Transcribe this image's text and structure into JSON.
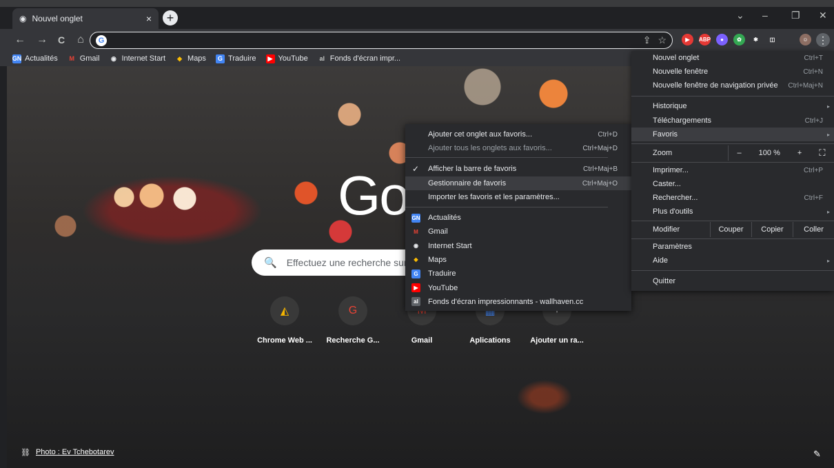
{
  "tab": {
    "title": "Nouvel onglet",
    "close": "×",
    "new_tab": "+"
  },
  "window_controls": {
    "collapse": "⌄",
    "minimize": "–",
    "restore": "❐",
    "close": "✕"
  },
  "nav": {
    "back": "←",
    "forward": "→",
    "reload": "C",
    "home": "⌂"
  },
  "omnibox": {
    "value": "",
    "google_icon": "G"
  },
  "omni_icons": {
    "share": "⇪",
    "star": "☆"
  },
  "extensions": [
    {
      "name": "red-circle-ext-icon",
      "label": "▶",
      "color": "#e53935"
    },
    {
      "name": "abp-ext-icon",
      "label": "ABP",
      "color": "#e53935"
    },
    {
      "name": "purple-ext-icon",
      "label": "●",
      "color": "#7b61ff"
    },
    {
      "name": "green-ext-icon",
      "label": "✿",
      "color": "#34a853"
    },
    {
      "name": "puzzle-ext-icon",
      "label": "✱",
      "color": "#35363a"
    },
    {
      "name": "sidepanel-icon",
      "label": "◫",
      "color": "#35363a"
    }
  ],
  "menu_button": "⋮",
  "bookmarks": [
    {
      "label": "Actualités",
      "icon": "GN",
      "color": "#4285f4"
    },
    {
      "label": "Gmail",
      "icon": "M",
      "color": "#35363a",
      "fg": "#ea4335"
    },
    {
      "label": "Internet Start",
      "icon": "◉",
      "color": "#35363a",
      "fg": "#e8eaed"
    },
    {
      "label": "Maps",
      "icon": "◆",
      "color": "#35363a",
      "fg": "#fbbc04"
    },
    {
      "label": "Traduire",
      "icon": "G",
      "color": "#4285f4"
    },
    {
      "label": "YouTube",
      "icon": "▶",
      "color": "#ff0000"
    },
    {
      "label": "Fonds d'écran impr...",
      "icon": "al",
      "color": "#35363a",
      "fg": "#c4c7c5"
    }
  ],
  "page": {
    "google_logo": "Go",
    "search_placeholder": "Effectuez une recherche sur",
    "search_icon": "🔍",
    "shortcuts": [
      {
        "name": "Chrome Web ...",
        "icon": "◭",
        "color": "#f4b400"
      },
      {
        "name": "Recherche G...",
        "icon": "G",
        "color": "#ea4335"
      },
      {
        "name": "Gmail",
        "icon": "M",
        "color": "#ea4335"
      },
      {
        "name": "Aplications",
        "icon": "▦",
        "color": "#4285f4"
      },
      {
        "name": "Ajouter un ra...",
        "icon": "+",
        "color": "#e8eaed"
      }
    ],
    "photo_credit": "Photo : Ev Tchebotarev",
    "link_icon": "⛓",
    "pencil_icon": "✎"
  },
  "main_menu": {
    "items": [
      {
        "label": "Nouvel onglet",
        "shortcut": "Ctrl+T"
      },
      {
        "label": "Nouvelle fenêtre",
        "shortcut": "Ctrl+N"
      },
      {
        "label": "Nouvelle fenêtre de navigation privée",
        "shortcut": "Ctrl+Maj+N"
      },
      {
        "label": "Historique",
        "shortcut": ""
      },
      {
        "label": "Téléchargements",
        "shortcut": "Ctrl+J"
      },
      {
        "label": "Favoris",
        "shortcut": ""
      },
      {
        "label": "Imprimer...",
        "shortcut": "Ctrl+P"
      },
      {
        "label": "Caster...",
        "shortcut": ""
      },
      {
        "label": "Rechercher...",
        "shortcut": "Ctrl+F"
      },
      {
        "label": "Plus d'outils",
        "shortcut": ""
      },
      {
        "label": "Paramètres",
        "shortcut": ""
      },
      {
        "label": "Aide",
        "shortcut": ""
      },
      {
        "label": "Quitter",
        "shortcut": ""
      }
    ],
    "zoom": {
      "label": "Zoom",
      "minus": "–",
      "value": "100 %",
      "plus": "+",
      "fullscreen": "⛶"
    },
    "edit": {
      "label": "Modifier",
      "cut": "Couper",
      "copy": "Copier",
      "paste": "Coller"
    },
    "arrow": "▸"
  },
  "bookmarks_submenu": {
    "items": [
      {
        "label": "Ajouter cet onglet aux favoris...",
        "shortcut": "Ctrl+D"
      },
      {
        "label": "Ajouter tous les onglets aux favoris...",
        "shortcut": "Ctrl+Maj+D"
      },
      {
        "label": "Afficher la barre de favoris",
        "shortcut": "Ctrl+Maj+B"
      },
      {
        "label": "Gestionnaire de favoris",
        "shortcut": "Ctrl+Maj+O"
      },
      {
        "label": "Importer les favoris et les paramètres...",
        "shortcut": ""
      }
    ],
    "check": "✓",
    "bookmark_list": [
      {
        "label": "Actualités",
        "icon": "GN",
        "color": "#4285f4"
      },
      {
        "label": "Gmail",
        "icon": "M",
        "color": "#292a2d",
        "fg": "#ea4335"
      },
      {
        "label": "Internet Start",
        "icon": "◉",
        "color": "#292a2d",
        "fg": "#e8eaed"
      },
      {
        "label": "Maps",
        "icon": "◆",
        "color": "#292a2d",
        "fg": "#fbbc04"
      },
      {
        "label": "Traduire",
        "icon": "G",
        "color": "#4285f4"
      },
      {
        "label": "YouTube",
        "icon": "▶",
        "color": "#ff0000"
      },
      {
        "label": "Fonds d'écran impressionnants - wallhaven.cc",
        "icon": "al",
        "color": "#5f6368"
      }
    ]
  }
}
